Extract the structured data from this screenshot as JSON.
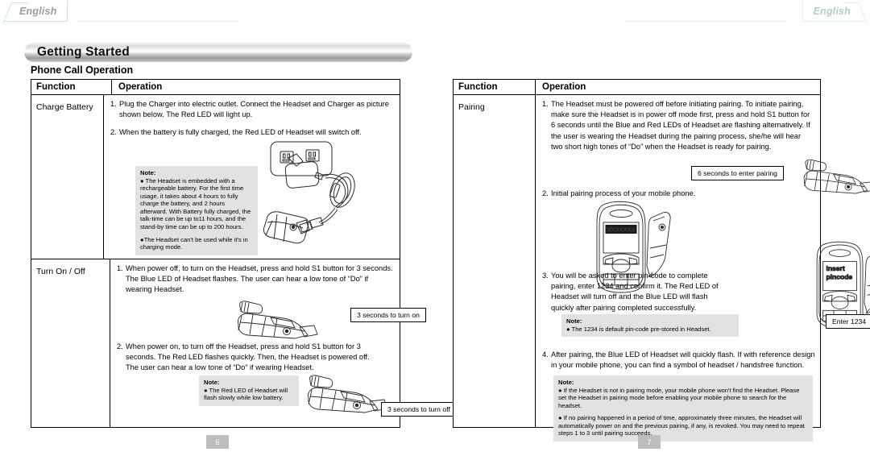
{
  "tabs": {
    "left_label": "English",
    "right_label": "English"
  },
  "header": {
    "title": "Getting Started",
    "subtitle": "Phone Call Operation"
  },
  "left_page": {
    "number": "6",
    "table": {
      "headers": {
        "function": "Function",
        "operation": "Operation"
      },
      "rows": [
        {
          "function": "Charge Battery",
          "steps": [
            {
              "num": "1.",
              "text": "Plug the Charger into electric outlet. Connect the Headset and Charger as picture shown below. The Red LED will light up."
            },
            {
              "num": "2.",
              "text": "When the battery is fully charged, the Red LED of Headset will switch off."
            }
          ],
          "note": {
            "title": "Note:",
            "bullets": [
              "● The Headset is embedded with a rechargeable battery. For the first time usage, it takes about 4 hours to fully charge the battery, and 2 hours afterward. With Battery fully charged, the talk-time can be up to11 hours, and the stand-by time can be up to 200 hours.",
              "●The Headset can't be used while it's in charging mode."
            ]
          },
          "figure": "charger-outlet-headset-illustration"
        },
        {
          "function": "Turn On / Off",
          "steps": [
            {
              "num": "1.",
              "text": "When power off, to turn on the Headset, press and hold S1 button for 3 seconds. The Blue LED of Headset flashes. The user can hear a low tone of “Do” if wearing Headset."
            },
            {
              "num": "2.",
              "text": "When power on, to turn off the Headset, press and hold S1 button for 3 seconds. The Red LED flashes quickly. Then, the Headset is powered off. The user can hear a low tone of “Do” if wearing Headset."
            }
          ],
          "callout_on": "3 seconds to turn on",
          "callout_off": "3 seconds to turn off",
          "note": {
            "title": "Note:",
            "bullets": [
              "● The Red LED of Headset will flash slowly while low battery."
            ]
          }
        }
      ]
    }
  },
  "right_page": {
    "number": "7",
    "table": {
      "headers": {
        "function": "Function",
        "operation": "Operation"
      },
      "rows": [
        {
          "function": "Pairing",
          "steps": [
            {
              "num": "1.",
              "text": "The Headset must be powered off before initiating pairing. To initiate pairing, make sure the Headset is in power off mode first, press and hold S1 button for 6 seconds until the Blue and Red LEDs of Headset are flashing alternatively. If the user is wearing the Headset during the pairing process, she/he will hear two short high tones of “Do” when the Headset is ready for pairing."
            },
            {
              "num": "2.",
              "text": "Initial pairing process of your mobile phone."
            },
            {
              "num": "3.",
              "text": "You will be asked to enter pin-code to complete pairing, enter 1234 and confirm it. The Red LED of Headset will turn off and the Blue LED will flash quickly after pairing completed successfully."
            },
            {
              "num": "4.",
              "text": "After pairing, the Blue LED of Headset will quickly flash. If with reference design in your mobile phone, you can find a symbol of headset / handsfree function."
            }
          ],
          "callout_pairing": "6 seconds to enter pairing",
          "callout_pincode": "Enter 1234",
          "phone_screen_1": "XXXXXXX",
          "phone_screen_2_line1": "insert",
          "phone_screen_2_line2": "pincode",
          "note_pin": {
            "title": "Note:",
            "bullets": [
              "● The 1234 is default pin-code pre-stored in Headset."
            ]
          },
          "note_final": {
            "title": "Note:",
            "bullets": [
              "● If the Headset is not in pairing mode, your mobile phone won't find the Headset. Please set the Headset in pairing mode before enabling your mobile phone to search for the headset.",
              "● If no pairing happened in a period of time, approximately three minutes, the Headset will automatically power on and the previous pairing, if any, is revoked. You may need to repeat steps 1 to 3 until pairing succeeds."
            ]
          }
        }
      ]
    }
  },
  "colors": {
    "note_bg": "#e2e2e2",
    "page_num_bg": "#bdbdbd",
    "tab_line": "#c9e3e8"
  }
}
